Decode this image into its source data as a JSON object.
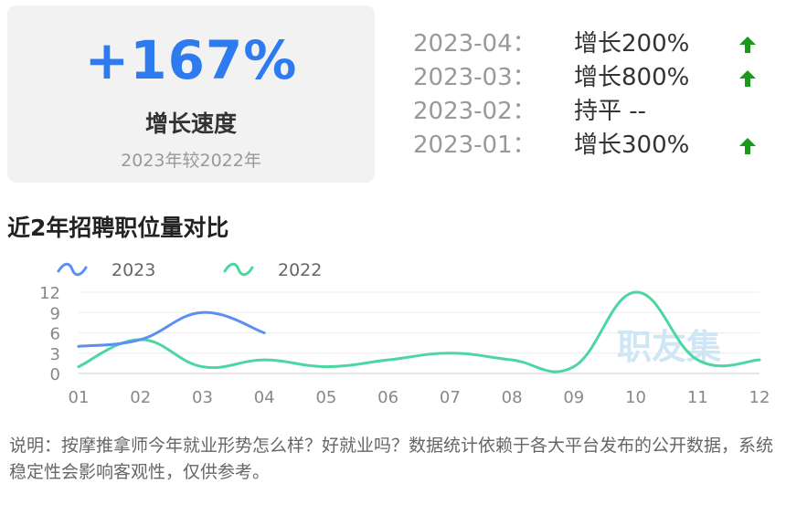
{
  "summary": {
    "percent": "+167%",
    "label": "增长速度",
    "sub": "2023年较2022年"
  },
  "monthly": [
    {
      "date": "2023-04：",
      "value": "增长200%",
      "trend": "up"
    },
    {
      "date": "2023-03：",
      "value": "增长800%",
      "trend": "up"
    },
    {
      "date": "2023-02：",
      "value": "持平 --",
      "trend": "flat"
    },
    {
      "date": "2023-01：",
      "value": "增长300%",
      "trend": "up"
    }
  ],
  "colors": {
    "accent": "#2e7bf0",
    "up_arrow": "#1a9a1a",
    "series_2023": "#5b8ff0",
    "series_2022": "#4cd6a0",
    "watermark": "#cfe7f4"
  },
  "chart_data": {
    "type": "line",
    "title": "近2年招聘职位量对比",
    "x": [
      "01",
      "02",
      "03",
      "04",
      "05",
      "06",
      "07",
      "08",
      "09",
      "10",
      "11",
      "12"
    ],
    "ylim": [
      0,
      12
    ],
    "yticks": [
      "0",
      "3",
      "6",
      "9",
      "12"
    ],
    "legend_position": "top-left",
    "grid": true,
    "smooth": true,
    "series": [
      {
        "name": "2023",
        "values": [
          4,
          5,
          9,
          6
        ]
      },
      {
        "name": "2022",
        "values": [
          1,
          5,
          1,
          2,
          1,
          2,
          3,
          2,
          1,
          12,
          2,
          2
        ]
      }
    ],
    "watermark": "职友集"
  },
  "note": "说明：按摩推拿师今年就业形势怎么样？好就业吗？数据统计依赖于各大平台发布的公开数据，系统稳定性会影响客观性，仅供参考。"
}
